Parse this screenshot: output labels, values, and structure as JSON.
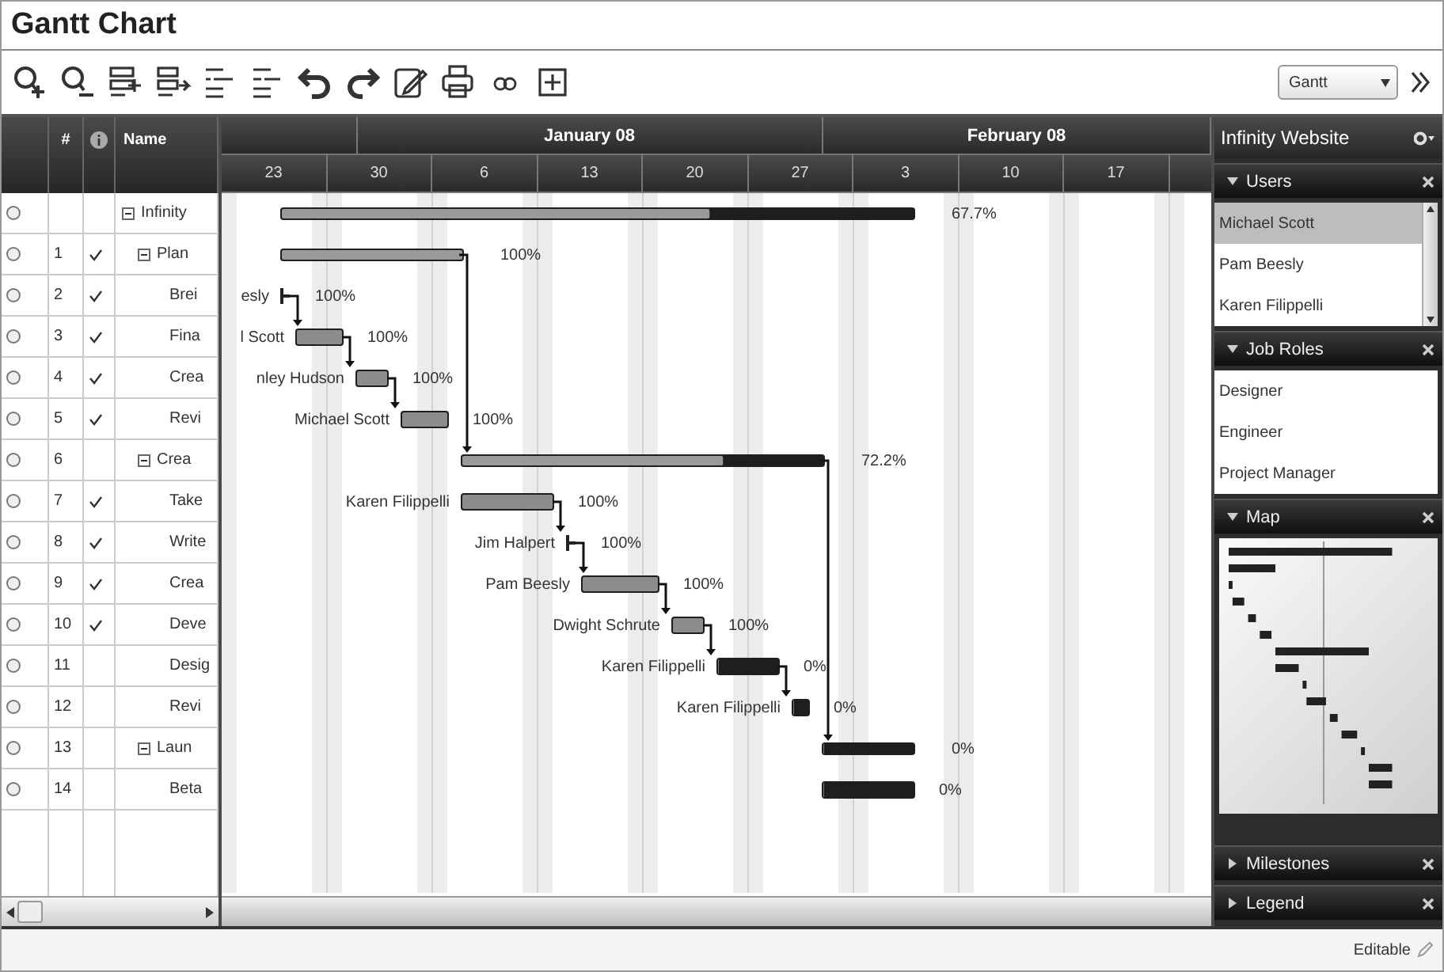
{
  "title": "Gantt Chart",
  "toolbar": {
    "view": "Gantt"
  },
  "grid": {
    "columns": [
      {
        "label": "#"
      },
      {
        "label": "Name"
      }
    ]
  },
  "timeline": {
    "months": [
      {
        "label": "January 08"
      },
      {
        "label": "February 08"
      }
    ],
    "weeks": [
      "23",
      "30",
      "6",
      "13",
      "20",
      "27",
      "3",
      "10",
      "17"
    ]
  },
  "tasks": [
    {
      "name": "Infinity",
      "done": false,
      "kind": "summary",
      "expanded": true,
      "percent": "67.7%",
      "level": 0.677,
      "children": [
        {
          "num": "1",
          "name": "Plan",
          "done": true,
          "kind": "summary",
          "expanded": true,
          "percent": "100%",
          "level": 1,
          "linked": true,
          "children": [
            {
              "num": "2",
              "name": "Brei",
              "done": true,
              "kind": "milestone",
              "resource": "esly",
              "percent": "100%",
              "linked": true
            },
            {
              "num": "3",
              "name": "Fina",
              "done": true,
              "kind": "task",
              "resource": "l Scott",
              "percent": "100%",
              "level": 1,
              "linked": true
            },
            {
              "num": "4",
              "name": "Crea",
              "done": true,
              "kind": "task",
              "resource": "nley Hudson",
              "percent": "100%",
              "level": 1,
              "linked": true
            },
            {
              "num": "5",
              "name": "Revi",
              "done": true,
              "kind": "task",
              "resource": "Michael Scott",
              "percent": "100%",
              "level": 1
            }
          ]
        },
        {
          "num": "6",
          "name": "Crea",
          "done": false,
          "kind": "summary",
          "expanded": true,
          "percent": "72.2%",
          "level": 0.722,
          "linked": true,
          "children": [
            {
              "num": "7",
              "name": "Take",
              "done": true,
              "kind": "task",
              "resource": "Karen Filippelli",
              "percent": "100%",
              "level": 1,
              "linked": true
            },
            {
              "num": "8",
              "name": "Write",
              "done": true,
              "kind": "milestone",
              "resource": "Jim Halpert",
              "percent": "100%",
              "linked": true
            },
            {
              "num": "9",
              "name": "Crea",
              "done": true,
              "kind": "task",
              "resource": "Pam Beesly",
              "percent": "100%",
              "level": 1,
              "linked": true
            },
            {
              "num": "10",
              "name": "Deve",
              "done": true,
              "kind": "task",
              "resource": "Dwight Schrute",
              "percent": "100%",
              "level": 1,
              "linked": true
            },
            {
              "num": "11",
              "name": "Desig",
              "done": false,
              "kind": "task",
              "resource": "Karen Filippelli",
              "percent": "0%",
              "level": 0,
              "linked": true
            },
            {
              "num": "12",
              "name": "Revi",
              "done": false,
              "kind": "task",
              "resource": "Karen Filippelli",
              "percent": "0%",
              "level": 0
            }
          ]
        },
        {
          "num": "13",
          "name": "Laun",
          "done": false,
          "kind": "summary",
          "expanded": true,
          "percent": "0%",
          "level": 0,
          "children": [
            {
              "num": "14",
              "name": "Beta",
              "done": false,
              "kind": "task",
              "percent": "0%",
              "level": 0
            }
          ]
        }
      ]
    }
  ],
  "side_panel": {
    "title": "Infinity Website",
    "sections": [
      {
        "title": "Users",
        "expanded": true,
        "kind": "list",
        "items": [
          {
            "label": "Michael Scott",
            "selected": true
          },
          {
            "label": "Pam Beesly",
            "selected": false
          },
          {
            "label": "Karen Filippelli",
            "selected": false
          }
        ]
      },
      {
        "title": "Job Roles",
        "expanded": true,
        "kind": "list",
        "items": [
          {
            "label": "Designer",
            "selected": false
          },
          {
            "label": "Engineer",
            "selected": false
          },
          {
            "label": "Project Manager",
            "selected": false
          }
        ]
      },
      {
        "title": "Map",
        "expanded": true,
        "kind": "map"
      },
      {
        "title": "Milestones",
        "expanded": false
      },
      {
        "title": "Legend",
        "expanded": false
      }
    ]
  },
  "status_bar": {
    "mode": "Editable"
  }
}
